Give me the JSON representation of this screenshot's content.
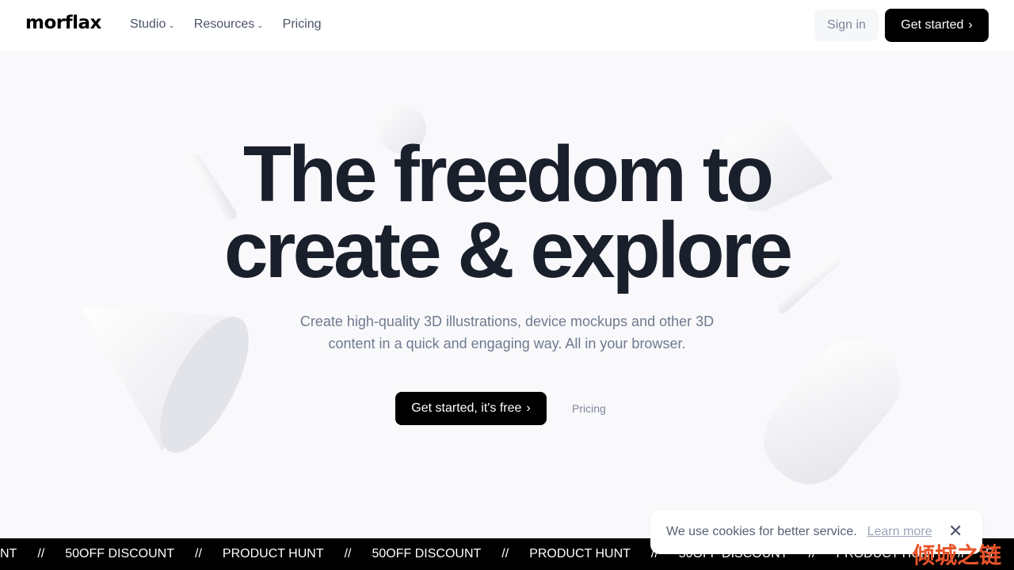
{
  "nav": {
    "logo": "morflax",
    "items": [
      {
        "label": "Studio",
        "chevron": "chevron-down-icon"
      },
      {
        "label": "Resources",
        "chevron": "chevron-down-icon"
      },
      {
        "label": "Pricing"
      }
    ],
    "sign_in": "Sign in",
    "get_started": "Get started"
  },
  "hero": {
    "title_line1": "The freedom to",
    "title_line2": "create & explore",
    "subtitle": "Create high-quality 3D illustrations, device mockups and other 3D content in a quick and engaging way. All in your browser.",
    "cta": "Get started, it's free",
    "secondary": "Pricing"
  },
  "ticker": [
    "NT",
    "//",
    "50OFF DISCOUNT",
    "//",
    "PRODUCT HUNT",
    "//",
    "50OFF DISCOUNT",
    "//",
    "PRODUCT HUNT",
    "//",
    "50OFF DISCOUNT",
    "//",
    "PRODUCT HUNT",
    "//",
    "5"
  ],
  "cookie": {
    "text": "We use cookies for better service.",
    "link": "Learn more"
  },
  "watermark": "倾城之链"
}
